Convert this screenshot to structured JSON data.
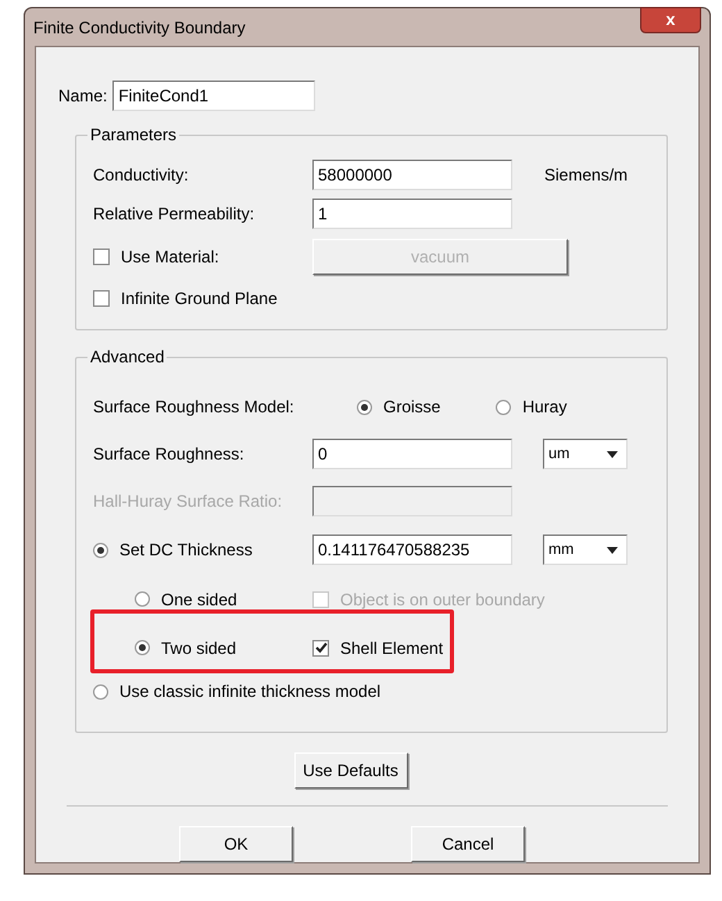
{
  "window": {
    "title": "Finite Conductivity Boundary",
    "close": "x"
  },
  "name": {
    "label": "Name:",
    "value": "FiniteCond1"
  },
  "parameters": {
    "legend": "Parameters",
    "conductivity": {
      "label": "Conductivity:",
      "value": "58000000",
      "unit": "Siemens/m"
    },
    "permeability": {
      "label": "Relative Permeability:",
      "value": "1"
    },
    "use_material": {
      "label": "Use Material:",
      "checked": false,
      "button": "vacuum",
      "button_disabled": true
    },
    "infinite_ground": {
      "label": "Infinite Ground Plane",
      "checked": false
    }
  },
  "advanced": {
    "legend": "Advanced",
    "roughness_model": {
      "label": "Surface Roughness Model:",
      "options": [
        {
          "label": "Groisse",
          "selected": true
        },
        {
          "label": "Huray",
          "selected": false
        }
      ]
    },
    "roughness": {
      "label": "Surface Roughness:",
      "value": "0",
      "unit": "um"
    },
    "hall_huray": {
      "label": "Hall-Huray Surface Ratio:",
      "disabled": true
    },
    "dc_thickness": {
      "label": "Set DC Thickness",
      "selected": true,
      "value": "0.141176470588235",
      "unit": "mm"
    },
    "one_sided": {
      "label": "One sided",
      "selected": false,
      "checkbox": {
        "label": "Object is on outer boundary",
        "checked": false,
        "disabled": true
      }
    },
    "two_sided": {
      "label": "Two sided",
      "selected": true,
      "checkbox": {
        "label": "Shell Element",
        "checked": true,
        "disabled": false
      }
    },
    "classic": {
      "label": "Use classic infinite thickness model",
      "selected": false
    }
  },
  "use_defaults": "Use Defaults",
  "buttons": [
    "OK",
    "Cancel"
  ]
}
